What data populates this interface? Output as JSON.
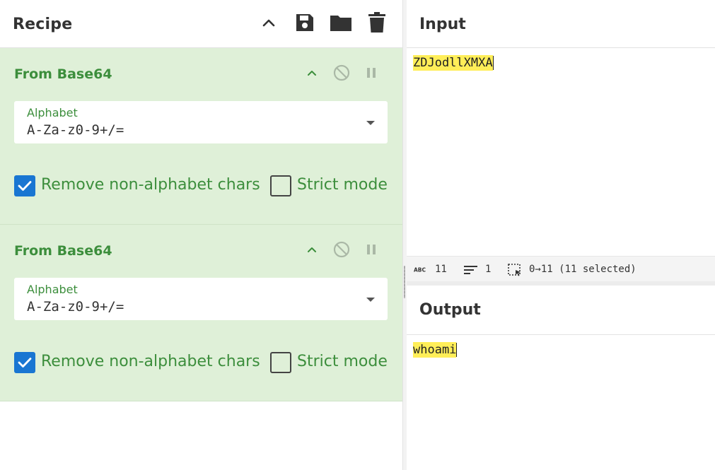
{
  "recipe": {
    "title": "Recipe",
    "toolbar_icons": [
      "chevron-up-icon",
      "save-icon",
      "folder-icon",
      "trash-icon"
    ],
    "operations": [
      {
        "title": "From Base64",
        "alphabet_label": "Alphabet",
        "alphabet_value": "A-Za-z0-9+/=",
        "remove_non_alphabet": {
          "label": "Remove non-alphabet chars",
          "checked": true
        },
        "strict_mode": {
          "label": "Strict mode",
          "checked": false
        }
      },
      {
        "title": "From Base64",
        "alphabet_label": "Alphabet",
        "alphabet_value": "A-Za-z0-9+/=",
        "remove_non_alphabet": {
          "label": "Remove non-alphabet chars",
          "checked": true
        },
        "strict_mode": {
          "label": "Strict mode",
          "checked": false
        }
      }
    ]
  },
  "input": {
    "title": "Input",
    "text": "ZDJodllXMXA"
  },
  "status": {
    "length": "11",
    "lines": "1",
    "selection": "0→11 (11 selected)"
  },
  "output": {
    "title": "Output",
    "text": "whoami"
  },
  "colors": {
    "operation_bg": "#dff0d8",
    "operation_text": "#3c8e3c",
    "checkbox_checked": "#1976d2",
    "highlight": "#ffee58"
  }
}
